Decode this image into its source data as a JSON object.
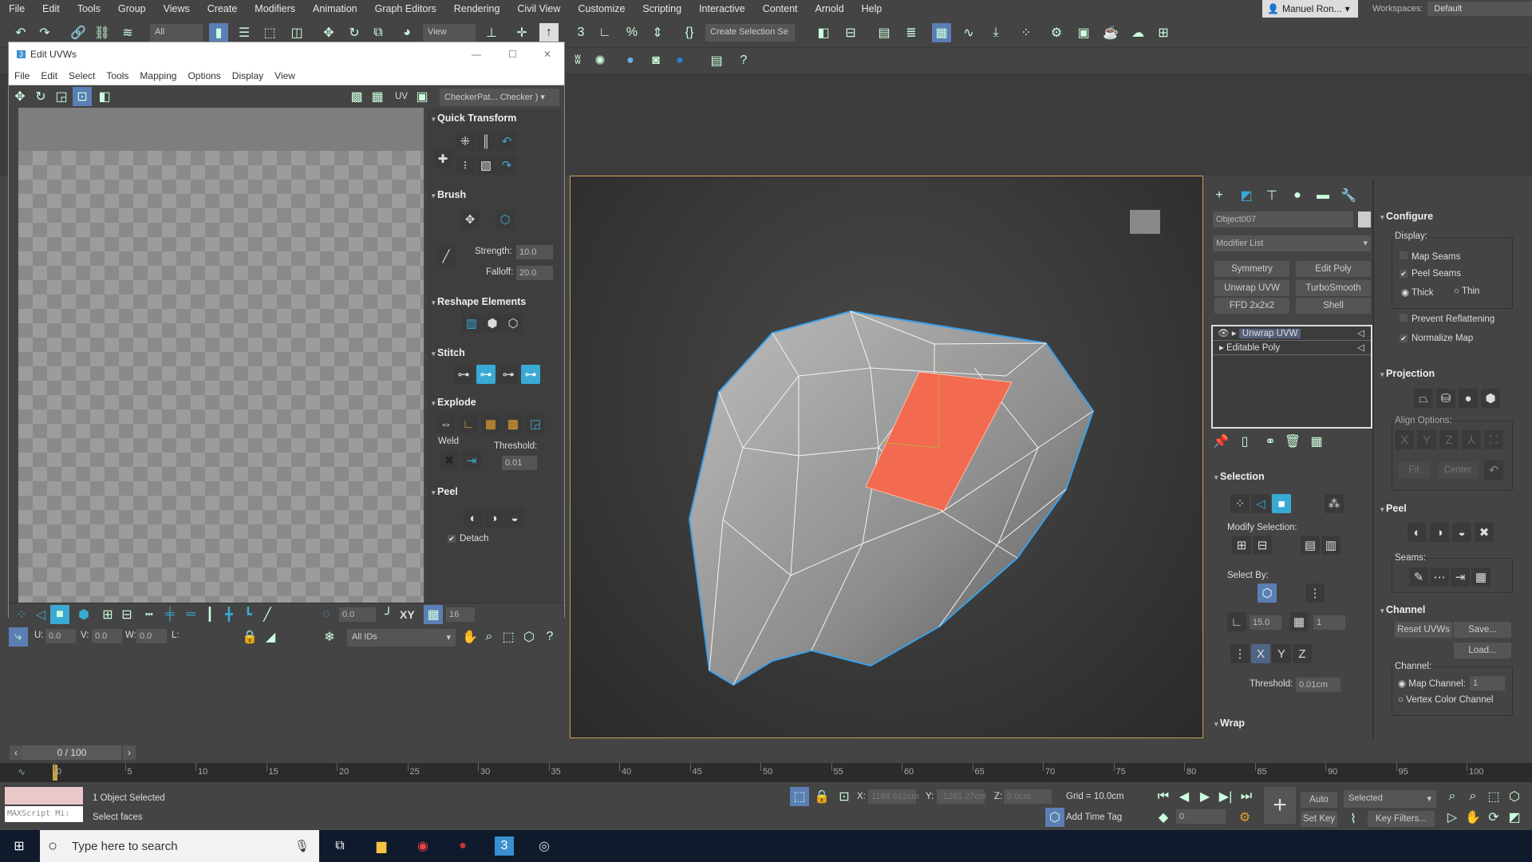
{
  "menubar": {
    "items": [
      "File",
      "Edit",
      "Tools",
      "Group",
      "Views",
      "Create",
      "Modifiers",
      "Animation",
      "Graph Editors",
      "Rendering",
      "Civil View",
      "Customize",
      "Scripting",
      "Interactive",
      "Content",
      "Arnold",
      "Help"
    ],
    "user": "Manuel Ron...",
    "workspaces_label": "Workspaces:",
    "workspace": "Default"
  },
  "toolbar": {
    "selection_filter": "All",
    "ref_coord": "View",
    "named_selection": "Create Selection Se"
  },
  "uvw": {
    "title": "Edit UVWs",
    "menu": [
      "File",
      "Edit",
      "Select",
      "Tools",
      "Mapping",
      "Options",
      "Display",
      "View"
    ],
    "uv_label": "UV",
    "checker": "CheckerPat... Checker )",
    "quick_transform": "Quick Transform",
    "brush": "Brush",
    "strength_label": "Strength:",
    "strength": "10.0",
    "falloff_label": "Falloff:",
    "falloff": "20.0",
    "reshape": "Reshape Elements",
    "stitch": "Stitch",
    "explode": "Explode",
    "weld": "Weld",
    "threshold_label": "Threshold:",
    "threshold": "0.01",
    "peel": "Peel",
    "detach": "Detach",
    "soft_value": "0.0",
    "xy": "XY",
    "grid_count": "16",
    "u_label": "U:",
    "u": "0.0",
    "v_label": "V:",
    "v": "0.0",
    "w_label": "W:",
    "w": "0.0",
    "l_label": "L:",
    "ids": "All IDs"
  },
  "cmd": {
    "object_name": "Object007",
    "modifier_list": "Modifier List",
    "mod_buttons": [
      "Symmetry",
      "Edit Poly",
      "Unwrap UVW",
      "TurboSmooth",
      "FFD 2x2x2",
      "Shell"
    ],
    "stack": [
      "Unwrap UVW",
      "Editable Poly"
    ],
    "selection": "Selection",
    "modify_selection": "Modify Selection:",
    "select_by": "Select By:",
    "angle": "15.0",
    "group": "1",
    "threshold_label": "Threshold:",
    "threshold": "0.01cm",
    "wrap": "Wrap",
    "configure": "Configure",
    "display": "Display:",
    "map_seams": "Map Seams",
    "peel_seams": "Peel Seams",
    "thick": "Thick",
    "thin": "Thin",
    "prevent": "Prevent Reflattening",
    "normalize": "Normalize Map",
    "projection": "Projection",
    "align_options": "Align Options:",
    "fit": "Fit",
    "center": "Center",
    "peel": "Peel",
    "seams": "Seams:",
    "channel": "Channel",
    "reset": "Reset UVWs",
    "save": "Save...",
    "load": "Load...",
    "channel_label": "Channel:",
    "map_channel": "Map Channel:",
    "map_channel_value": "1",
    "vertex_color": "Vertex Color Channel",
    "checks": {
      "map_seams": false,
      "peel_seams": true,
      "prevent": false,
      "normalize": true,
      "thick": true
    }
  },
  "timeline": {
    "frame": "0 / 100",
    "ticks": [
      "0",
      "5",
      "10",
      "15",
      "20",
      "25",
      "30",
      "35",
      "40",
      "45",
      "50",
      "55",
      "60",
      "65",
      "70",
      "75",
      "80",
      "85",
      "90",
      "95",
      "100"
    ]
  },
  "status": {
    "maxscript": "MAXScript Mi:",
    "selected": "1 Object Selected",
    "prompt": "Select faces",
    "x_label": "X:",
    "x": "1188.612cm",
    "y_label": "Y:",
    "y": "-1281.27cm",
    "z_label": "Z:",
    "z": "0.0cm",
    "grid": "Grid = 10.0cm",
    "add_time_tag": "Add Time Tag",
    "frame": "0",
    "auto_key": "Auto Key",
    "set_key": "Set Key",
    "key_mode": "Selected",
    "key_filters": "Key Filters..."
  },
  "taskbar": {
    "search_placeholder": "Type here to search"
  },
  "colors": {
    "selected_face": "#f26a4f",
    "seam": "#3aa0e8",
    "accent": "#3aa9d4"
  }
}
